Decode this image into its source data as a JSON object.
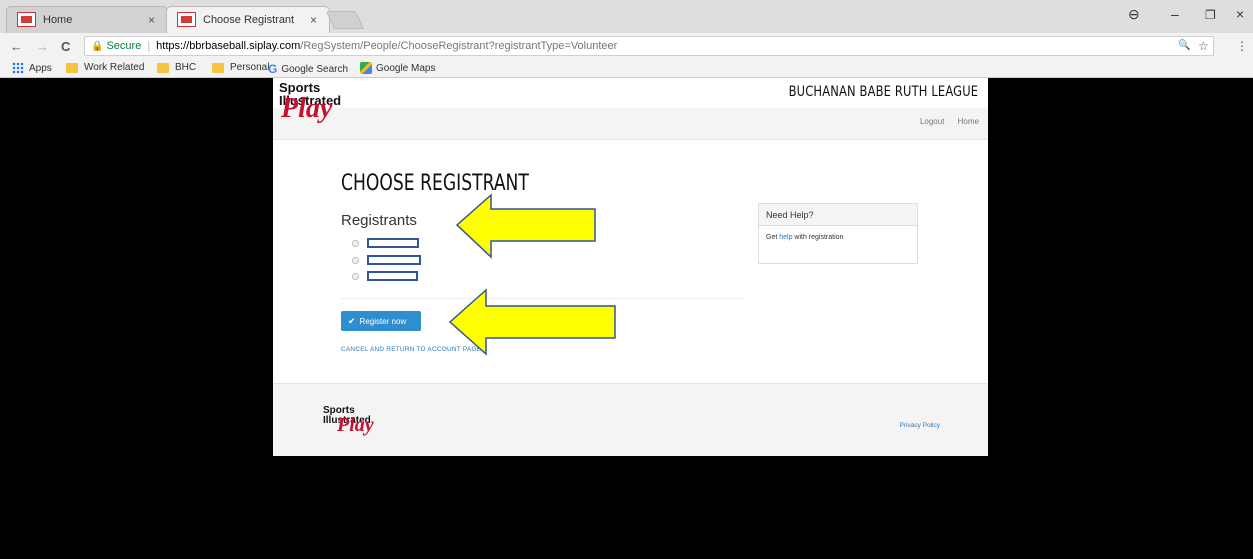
{
  "browser": {
    "tabs": [
      {
        "label": "Home",
        "close": "×"
      },
      {
        "label": "Choose Registrant",
        "close": "×"
      }
    ],
    "window_controls": {
      "profile": "⊖",
      "minimize": "–",
      "restore": "❐",
      "close": "×"
    },
    "nav": {
      "back": "←",
      "forward": "→",
      "reload": "C"
    },
    "address": {
      "secure_label": "Secure",
      "url_host": "https://bbrbaseball.siplay.com",
      "url_rest": "/RegSystem/People/ChooseRegistrant?registrantType=Volunteer"
    },
    "address_icons": {
      "zoom": "🔍",
      "star": "☆",
      "menu": "⋮"
    },
    "bookmarks": [
      {
        "label": "Apps",
        "icon": "apps-icon"
      },
      {
        "label": "Work Related",
        "icon": "folder-icon"
      },
      {
        "label": "BHC",
        "icon": "folder-icon"
      },
      {
        "label": "Personal",
        "icon": "folder-icon"
      },
      {
        "label": "Google Search",
        "icon": "google-icon"
      },
      {
        "label": "Google Maps",
        "icon": "maps-icon"
      }
    ]
  },
  "site": {
    "logo_line1": "Sports Illustrated",
    "logo_line2": "Play",
    "league_title": "BUCHANAN BABE RUTH LEAGUE",
    "header_links": [
      "Logout",
      "Home"
    ],
    "accent": "#c8102e"
  },
  "main": {
    "page_title": "CHOOSE REGISTRANT",
    "registrants_heading": "Registrants",
    "register_button": "Register now",
    "cancel_link": "CANCEL AND RETURN TO ACCOUNT PAGE"
  },
  "help": {
    "heading": "Need Help?",
    "body_prefix": "Get ",
    "body_link": "help",
    "body_suffix": " with registration"
  },
  "footer": {
    "privacy_link": "Privacy Policy"
  },
  "colors": {
    "button": "#2e8fcf",
    "link": "#2e7bb8",
    "annotation_arrow": "#ffff00",
    "redaction_border": "#2f5597"
  }
}
